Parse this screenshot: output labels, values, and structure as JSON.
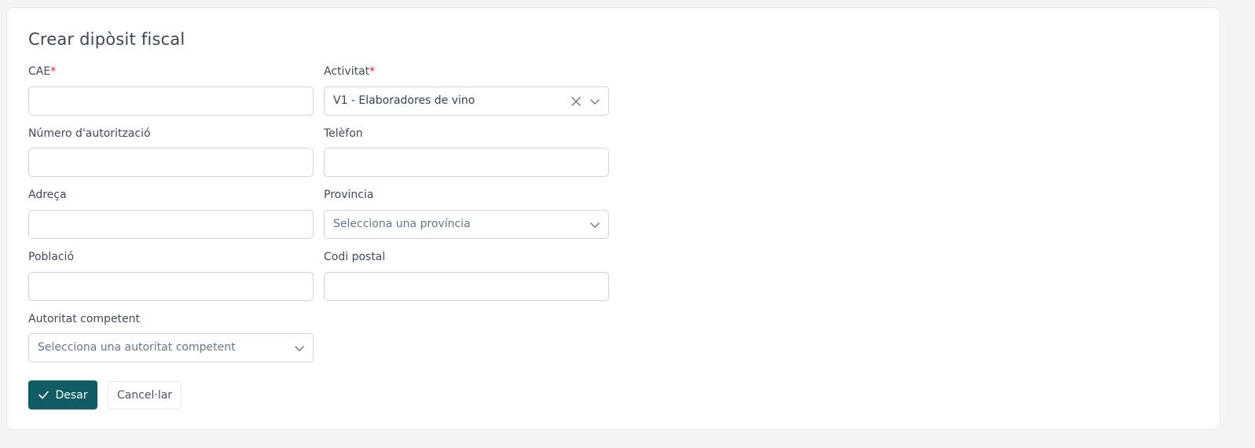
{
  "form": {
    "title": "Crear dipòsit fiscal",
    "required_marker": "*",
    "fields": {
      "cae": {
        "label": "CAE",
        "value": "",
        "required": true
      },
      "activitat": {
        "label": "Activitat",
        "value": "V1 - Elaboradores de vino",
        "required": true
      },
      "numero_autoritzacio": {
        "label": "Número d'autorització",
        "value": ""
      },
      "telefon": {
        "label": "Telèfon",
        "value": ""
      },
      "adreca": {
        "label": "Adreça",
        "value": ""
      },
      "provincia": {
        "label": "Provincia",
        "placeholder": "Selecciona una província"
      },
      "poblacio": {
        "label": "Població",
        "value": ""
      },
      "codi_postal": {
        "label": "Codi postal",
        "value": ""
      },
      "autoritat_competent": {
        "label": "Autoritat competent",
        "placeholder": "Selecciona una autoritat competent"
      }
    },
    "actions": {
      "save_label": "Desar",
      "cancel_label": "Cancel·lar"
    }
  },
  "colors": {
    "primary": "#0f5c63",
    "required": "#e11d48",
    "border": "#cbd5e1"
  },
  "icons": {
    "save": "check-icon",
    "select": "chevron-down-icon",
    "clear": "close-icon"
  }
}
